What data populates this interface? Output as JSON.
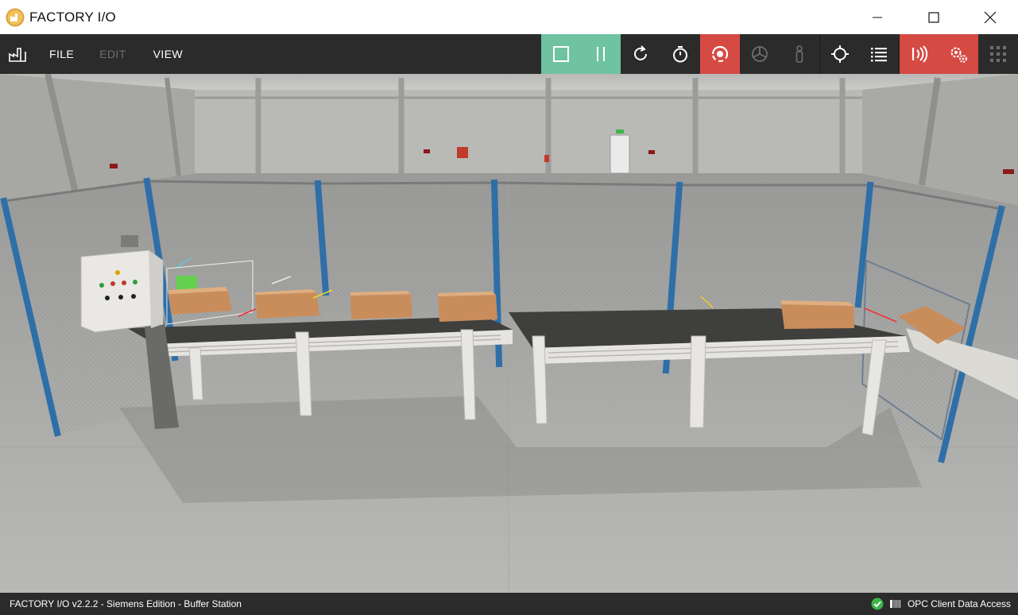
{
  "window": {
    "title": "FACTORY I/O"
  },
  "menu": {
    "file": "FILE",
    "edit": "EDIT",
    "view": "VIEW"
  },
  "toolbar_icons": [
    "stop-icon",
    "pause-icon",
    "reset-icon",
    "timer-icon",
    "camera-orbit-icon",
    "fly-camera-icon",
    "first-person-icon",
    "target-icon",
    "list-icon",
    "sensor-icon",
    "drivers-icon",
    "grid-icon"
  ],
  "colors": {
    "play_controls": "#6fc3a0",
    "active": "#d64a44",
    "toolbar": "#2b2b2b",
    "status_ok": "#3db54a"
  },
  "status": {
    "left": "FACTORY I/O v2.2.2 - Siemens Edition - Buffer Station",
    "driver": "OPC Client Data Access"
  }
}
